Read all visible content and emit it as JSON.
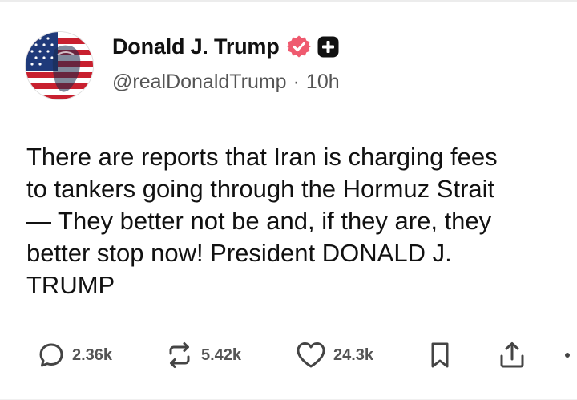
{
  "post": {
    "author": {
      "display_name": "Donald J. Trump",
      "handle": "@realDonaldTrump",
      "separator": "·",
      "time_ago": "10h",
      "verified": true
    },
    "text": "There are reports that Iran is charging fees\nto tankers going through the Hormuz Strait\n— They better not be and, if they are, they\nbetter stop now! President DONALD J.\nTRUMP",
    "stats": {
      "replies": "2.36k",
      "reposts": "5.42k",
      "likes": "24.3k"
    }
  },
  "icons": {
    "verified": "verified-badge-icon",
    "plus": "plus-badge-icon",
    "reply": "reply-bubble-icon",
    "repost": "repost-arrows-icon",
    "like": "heart-icon",
    "bookmark": "bookmark-icon",
    "share": "share-upload-icon",
    "more": "more-dots-icon"
  },
  "colors": {
    "verified_badge": "#ef5a6f",
    "text": "#111111",
    "muted": "#555555",
    "icon": "#444444"
  }
}
